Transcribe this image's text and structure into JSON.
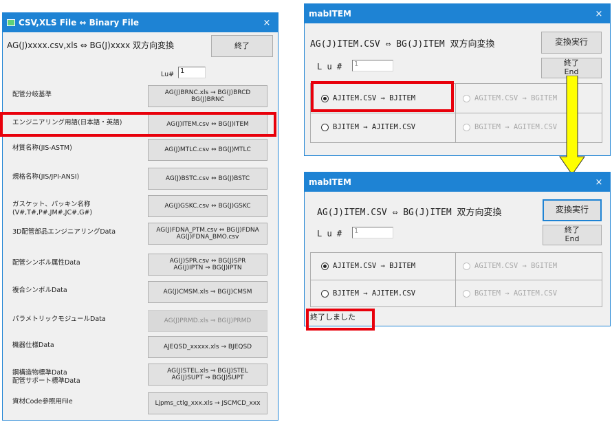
{
  "left_window": {
    "title": "CSV,XLS File ⇔ Binary File",
    "close": "×",
    "header": "AG(J)xxxx.csv,xls ⇔ BG(J)xxxx 双方向変換",
    "exit_button": "終了",
    "lu_label": "Lu#",
    "lu_value": "1",
    "rows": [
      {
        "label": "配管分岐基準",
        "button": "AG(J)BRNC.xls → BG(J)BRCD\nBG(J)BRNC",
        "enabled": true
      },
      {
        "label": "エンジニアリング用語(日本語・英語)",
        "button": "AG(J)ITEM.csv ⇔ BG(J)ITEM",
        "enabled": true
      },
      {
        "label": "材質名称(JIS-ASTM)",
        "button": "AG(J)MTLC.csv ⇔ BG(J)MTLC",
        "enabled": true
      },
      {
        "label": "規格名称(JIS/JPI-ANSI)",
        "button": "AG(J)BSTC.csv ⇔ BG(J)BSTC",
        "enabled": true
      },
      {
        "label": "ガスケット、パッキン名称\n(V#,T#,P#,JM#,JC#,G#)",
        "button": "AG(J)GSKC.csv ⇔ BG(J)GSKC",
        "enabled": true
      },
      {
        "label": "3D配管部品エンジニアリングData",
        "button": "AG(J)FDNA_PTM.csv ⇔ BG(J)FDNA\nAG(J)FDNA_BMO.csv",
        "enabled": true
      },
      {
        "label": "配管シンボル属性Data",
        "button": "AG(J)SPR.csv ⇔ BG(J)SPR\nAG(J)IPTN ⇒ BG(J)IPTN",
        "enabled": true
      },
      {
        "label": "複合シンボルData",
        "button": "AG(J)CMSM.xls ⇒ BG(J)CMSM",
        "enabled": true
      },
      {
        "label": "パラメトリックモジュールData",
        "button": "AG(J)PRMD.xls ⇒ BG(J)PRMD",
        "enabled": false
      },
      {
        "label": "機器仕様Data",
        "button": "AJEQSD_xxxxx.xls → BJEQSD",
        "enabled": true
      },
      {
        "label": "鋼構造物標準Data\n配管サポート標準Data",
        "button": "AG(J)STEL.xls ⇒ BG(J)STEL\nAG(J)SUPT ⇒ BG(J)SUPT",
        "enabled": true
      },
      {
        "label": "資材Code参照用File",
        "button": "Ljpms_ctlg_xxx.xls → JSCMCD_xxx",
        "enabled": true
      }
    ]
  },
  "mab_top": {
    "title": "mabITEM",
    "close": "×",
    "header": "AG(J)ITEM.CSV ⇔ BG(J)ITEM 双方向変換",
    "run_button": "変換実行",
    "lu_label": "L u #",
    "lu_value": "1",
    "exit_button": "終了\nEnd",
    "opt1": "AJITEM.CSV → BJITEM",
    "opt2": "BJITEM → AJITEM.CSV",
    "opt3": "AGITEM.CSV → BGITEM",
    "opt4": "BGITEM → AGITEM.CSV"
  },
  "mab_bottom": {
    "title": "mabITEM",
    "close": "×",
    "header": "AG(J)ITEM.CSV ⇔ BG(J)ITEM 双方向変換",
    "run_button": "変換実行",
    "lu_label": "L u #",
    "lu_value": "1",
    "exit_button": "終了\nEnd",
    "opt1": "AJITEM.CSV → BJITEM",
    "opt2": "BJITEM → AJITEM.CSV",
    "opt3": "AGITEM.CSV → BGITEM",
    "opt4": "BGITEM → AGITEM.CSV",
    "status": "終了しました"
  },
  "colors": {
    "left_title_bg": "#1e83d4",
    "mab_title_bg": "#1e83d4",
    "highlight_red": "#e8000b",
    "arrow_yellow": "#ffff00"
  }
}
